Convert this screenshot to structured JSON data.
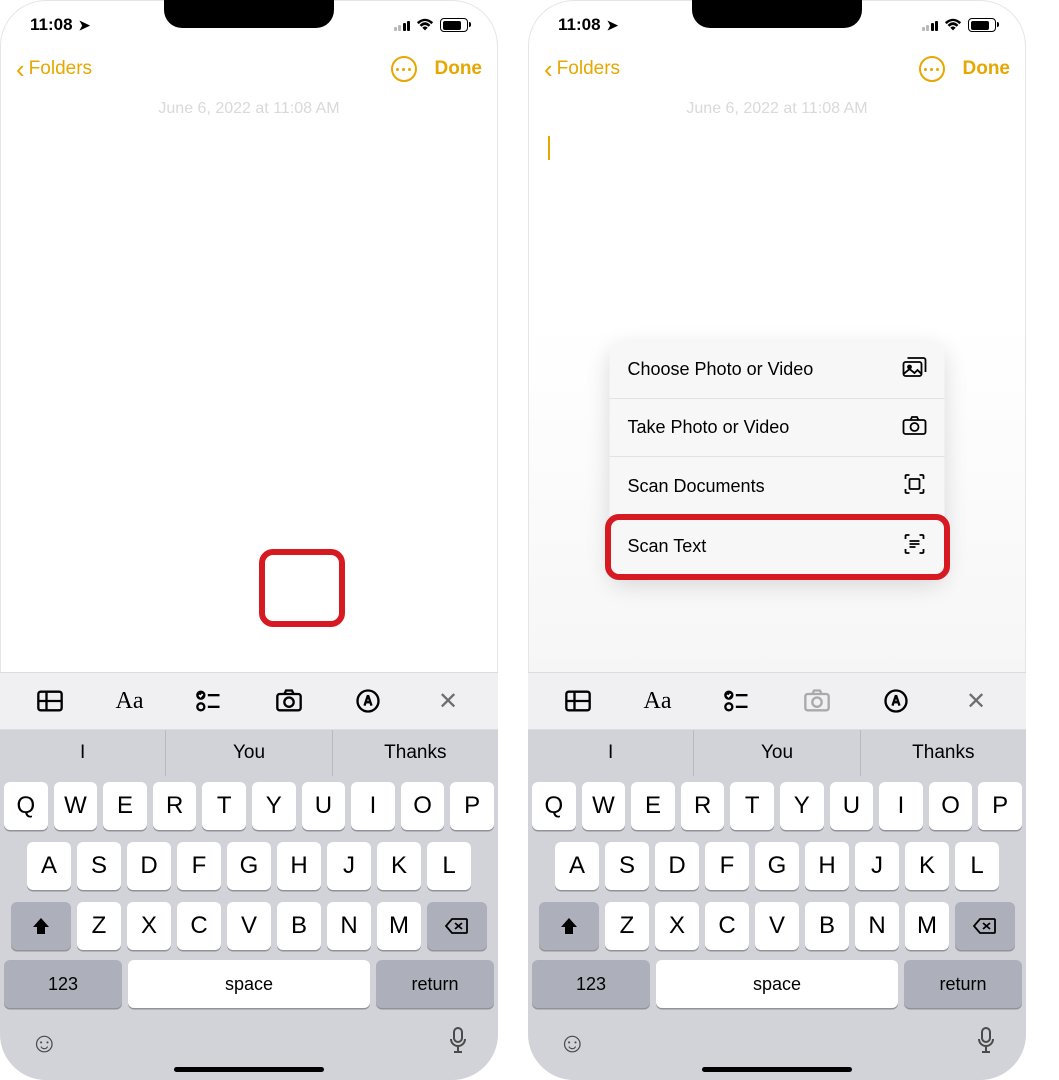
{
  "status": {
    "time": "11:08",
    "location_arrow": "↗"
  },
  "nav": {
    "back_label": "Folders",
    "done_label": "Done"
  },
  "note": {
    "date": "June 6, 2022 at 11:08 AM"
  },
  "popup": {
    "choose": "Choose Photo or Video",
    "take": "Take Photo or Video",
    "scan_docs": "Scan Documents",
    "scan_text": "Scan Text"
  },
  "suggestions": [
    "I",
    "You",
    "Thanks"
  ],
  "keys": {
    "row1": [
      "Q",
      "W",
      "E",
      "R",
      "T",
      "Y",
      "U",
      "I",
      "O",
      "P"
    ],
    "row2": [
      "A",
      "S",
      "D",
      "F",
      "G",
      "H",
      "J",
      "K",
      "L"
    ],
    "row3": [
      "Z",
      "X",
      "C",
      "V",
      "B",
      "N",
      "M"
    ],
    "num": "123",
    "space": "space",
    "return": "return"
  }
}
